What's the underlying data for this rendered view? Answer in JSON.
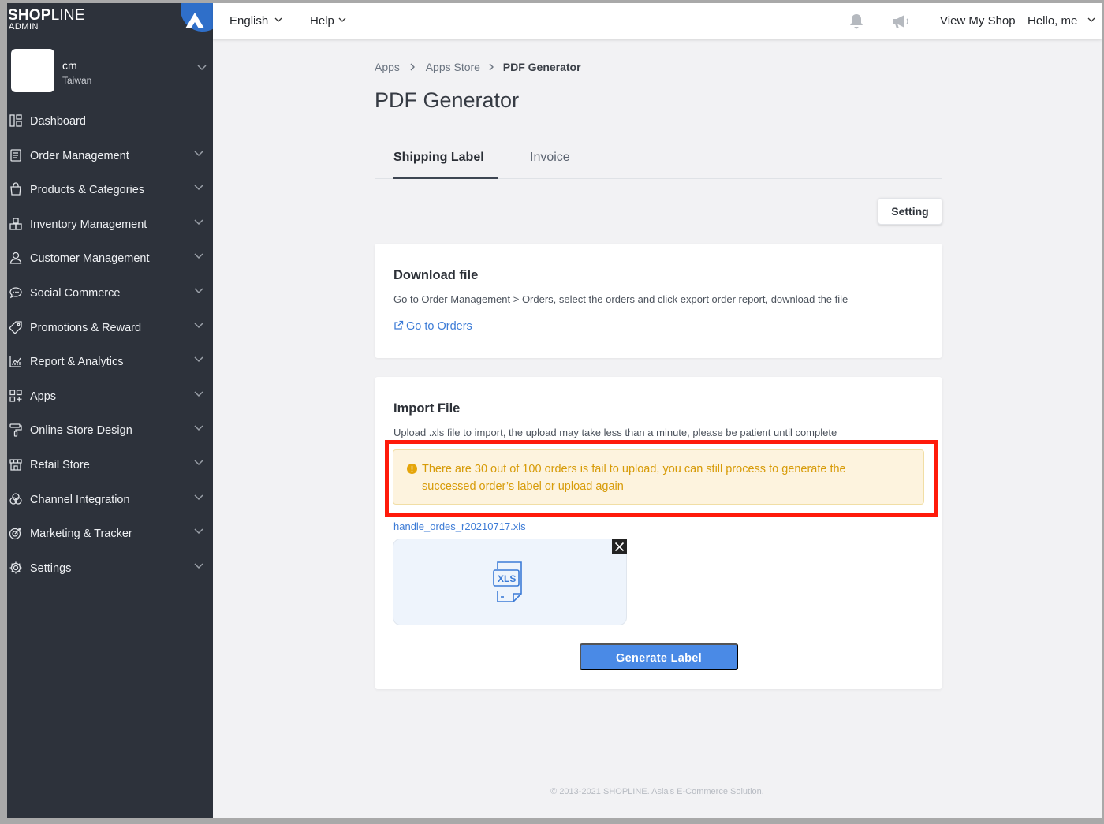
{
  "brand": {
    "name": "SHOPLINE",
    "sub": "ADMIN"
  },
  "account": {
    "name": "cm",
    "region": "Taiwan"
  },
  "sidebar": {
    "items": [
      {
        "label": "Dashboard",
        "icon": "dashboard-icon",
        "chevron": false
      },
      {
        "label": "Order Management",
        "icon": "order-icon",
        "chevron": true
      },
      {
        "label": "Products & Categories",
        "icon": "bag-icon",
        "chevron": true
      },
      {
        "label": "Inventory Management",
        "icon": "inventory-icon",
        "chevron": true
      },
      {
        "label": "Customer Management",
        "icon": "user-icon",
        "chevron": true
      },
      {
        "label": "Social Commerce",
        "icon": "chat-icon",
        "chevron": true
      },
      {
        "label": "Promotions & Reward",
        "icon": "tag-icon",
        "chevron": true
      },
      {
        "label": "Report & Analytics",
        "icon": "chart-icon",
        "chevron": true
      },
      {
        "label": "Apps",
        "icon": "apps-icon",
        "chevron": true
      },
      {
        "label": "Online Store Design",
        "icon": "brush-icon",
        "chevron": true
      },
      {
        "label": "Retail Store",
        "icon": "store-icon",
        "chevron": true
      },
      {
        "label": "Channel Integration",
        "icon": "channel-icon",
        "chevron": true
      },
      {
        "label": "Marketing & Tracker",
        "icon": "target-icon",
        "chevron": true
      },
      {
        "label": "Settings",
        "icon": "gear-icon",
        "chevron": true
      }
    ]
  },
  "topbar": {
    "language": "English",
    "help": "Help",
    "view_shop": "View My Shop",
    "greeting": "Hello, me"
  },
  "breadcrumb": {
    "apps": "Apps",
    "store": "Apps Store",
    "current": "PDF Generator"
  },
  "page": {
    "title": "PDF Generator"
  },
  "tabs": {
    "shipping": "Shipping Label",
    "invoice": "Invoice"
  },
  "setting_button": "Setting",
  "download": {
    "title": "Download file",
    "desc": "Go to Order Management > Orders, select the orders and click export order report, download the file",
    "link": "Go to Orders"
  },
  "import": {
    "title": "Import File",
    "desc": "Upload .xls file to import, the upload may take less than a minute, please be patient until complete",
    "warning": "There are 30 out of 100 orders is fail to upload, you can still process to generate the successed order’s label or upload again",
    "filename": "handle_ordes_r20210717.xls",
    "file_badge": "XLS",
    "generate_button": "Generate Label"
  },
  "footer": "© 2013-2021 SHOPLINE. Asia's E-Commerce Solution.",
  "colors": {
    "sidebar_bg": "#2d323b",
    "accent": "#4a8ae6",
    "link": "#3c7bd6",
    "warning_text": "#d79b08",
    "warning_bg": "#fdf3de",
    "highlight": "#ff1a0a"
  }
}
